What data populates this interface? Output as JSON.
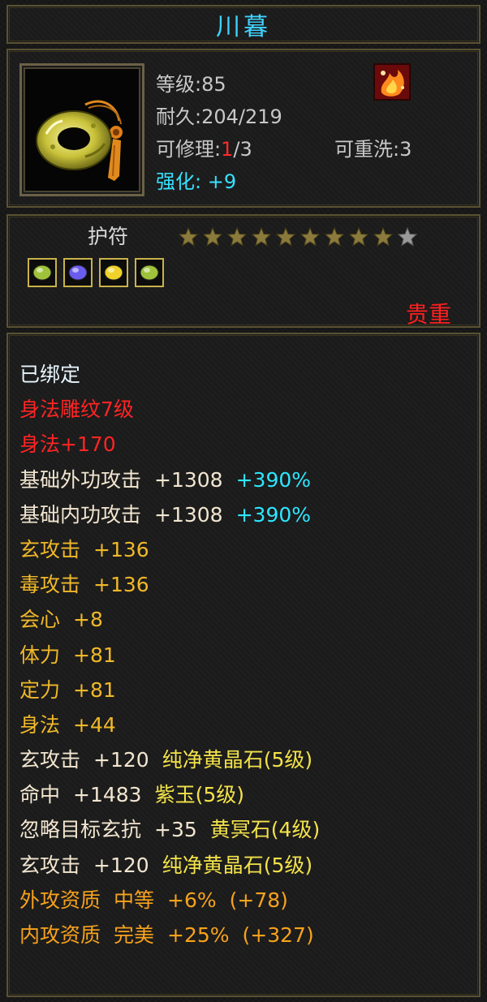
{
  "item": {
    "name": "川暮",
    "level_label": "等级",
    "level": "85",
    "durability_label": "耐久",
    "durability": "204/219",
    "repair_label": "可修理",
    "repair_used": "1",
    "repair_total": "/3",
    "reroll_label": "可重洗",
    "reroll": "3",
    "enhance_label": "强化",
    "enhance": "+9",
    "category": "护符",
    "star_count": 9,
    "star_total": 10,
    "quality": "贵重",
    "icon": "jade-ring-pendant-icon",
    "corner_icon": "fire-emblem-icon"
  },
  "gems": [
    {
      "icon": "green-gem-icon",
      "color": "#9fc23a"
    },
    {
      "icon": "purple-gem-icon",
      "color": "#6b5cf0"
    },
    {
      "icon": "yellow-gem-icon",
      "color": "#f0d22a"
    },
    {
      "icon": "green-gem-icon",
      "color": "#9fc23a"
    }
  ],
  "attributes": [
    {
      "parts": [
        {
          "t": "已绑定",
          "c": "white"
        }
      ]
    },
    {
      "parts": [
        {
          "t": "身法雕纹7级",
          "c": "red"
        }
      ]
    },
    {
      "parts": [
        {
          "t": "身法+170",
          "c": "red"
        }
      ]
    },
    {
      "parts": [
        {
          "t": "基础外功攻击",
          "c": "cream"
        },
        {
          "t": "+1308",
          "c": "cream"
        },
        {
          "t": "+390%",
          "c": "cyan"
        }
      ]
    },
    {
      "parts": [
        {
          "t": "基础内功攻击",
          "c": "cream"
        },
        {
          "t": "+1308",
          "c": "cream"
        },
        {
          "t": "+390%",
          "c": "cyan"
        }
      ]
    },
    {
      "parts": [
        {
          "t": "玄攻击",
          "c": "gold"
        },
        {
          "t": "+136",
          "c": "gold"
        }
      ]
    },
    {
      "parts": [
        {
          "t": "毒攻击",
          "c": "gold"
        },
        {
          "t": "+136",
          "c": "gold"
        }
      ]
    },
    {
      "parts": [
        {
          "t": "会心",
          "c": "gold"
        },
        {
          "t": "+8",
          "c": "gold"
        }
      ]
    },
    {
      "parts": [
        {
          "t": "体力",
          "c": "gold"
        },
        {
          "t": "+81",
          "c": "gold"
        }
      ]
    },
    {
      "parts": [
        {
          "t": "定力",
          "c": "gold"
        },
        {
          "t": "+81",
          "c": "gold"
        }
      ]
    },
    {
      "parts": [
        {
          "t": "身法",
          "c": "gold"
        },
        {
          "t": "+44",
          "c": "gold"
        }
      ]
    },
    {
      "parts": [
        {
          "t": "玄攻击",
          "c": "cream"
        },
        {
          "t": "+120",
          "c": "cream"
        },
        {
          "t": "纯净黄晶石(5级)",
          "c": "yellow"
        }
      ]
    },
    {
      "parts": [
        {
          "t": "命中",
          "c": "cream"
        },
        {
          "t": "+1483",
          "c": "cream"
        },
        {
          "t": "紫玉(5级)",
          "c": "yellow"
        }
      ]
    },
    {
      "parts": [
        {
          "t": "忽略目标玄抗",
          "c": "cream"
        },
        {
          "t": "+35",
          "c": "cream"
        },
        {
          "t": "黄冥石(4级)",
          "c": "yellow"
        }
      ]
    },
    {
      "parts": [
        {
          "t": "玄攻击",
          "c": "cream"
        },
        {
          "t": "+120",
          "c": "cream"
        },
        {
          "t": "纯净黄晶石(5级)",
          "c": "yellow"
        }
      ]
    },
    {
      "parts": [
        {
          "t": "外攻资质",
          "c": "orange"
        },
        {
          "t": "中等",
          "c": "orange"
        },
        {
          "t": "+6%",
          "c": "orange"
        },
        {
          "t": "(+78)",
          "c": "orange"
        }
      ]
    },
    {
      "parts": [
        {
          "t": "内攻资质",
          "c": "orange"
        },
        {
          "t": "完美",
          "c": "orange"
        },
        {
          "t": "+25%",
          "c": "orange"
        },
        {
          "t": "(+327)",
          "c": "orange"
        }
      ]
    }
  ],
  "colors": {
    "title": "#3fd3ff",
    "border": "#5a5232",
    "red": "#ff2424",
    "cyan": "#2ee6ff",
    "gold": "#f0b829",
    "yellow": "#f3e24a",
    "orange": "#f7a21c"
  }
}
